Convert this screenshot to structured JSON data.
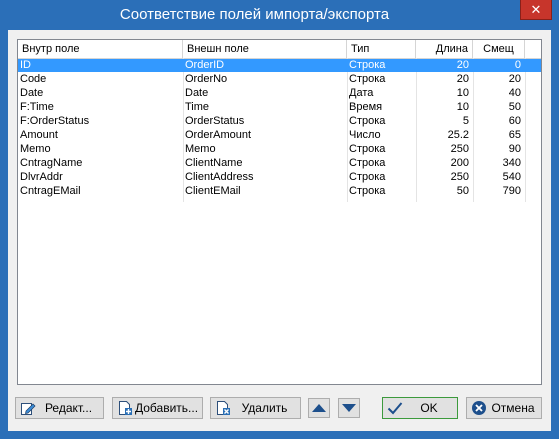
{
  "window": {
    "title": "Соответствие полей импорта/экспорта",
    "close_label": "✕"
  },
  "table": {
    "columns": [
      "Внутр поле",
      "Внешн поле",
      "Тип",
      "Длина",
      "Смещ"
    ],
    "rows": [
      [
        "ID",
        "OrderID",
        "Строка",
        "20",
        "0"
      ],
      [
        "Code",
        "OrderNo",
        "Строка",
        "20",
        "20"
      ],
      [
        "Date",
        "Date",
        "Дата",
        "10",
        "40"
      ],
      [
        "F:Time",
        "Time",
        "Время",
        "10",
        "50"
      ],
      [
        "F:OrderStatus",
        "OrderStatus",
        "Строка",
        "5",
        "60"
      ],
      [
        "Amount",
        "OrderAmount",
        "Число",
        "25.2",
        "65"
      ],
      [
        "Memo",
        "Memo",
        "Строка",
        "250",
        "90"
      ],
      [
        "CntragName",
        "ClientName",
        "Строка",
        "200",
        "340"
      ],
      [
        "DlvrAddr",
        "ClientAddress",
        "Строка",
        "250",
        "540"
      ],
      [
        "CntragEMail",
        "ClientEMail",
        "Строка",
        "50",
        "790"
      ]
    ],
    "selected_row": "ID"
  },
  "buttons": {
    "edit": "Редакт...",
    "add": "Добавить...",
    "delete": "Удалить",
    "ok": "OK",
    "cancel": "Отмена"
  },
  "colors": {
    "titlebar": "#2b6fb8",
    "selection": "#3399ff",
    "close": "#c7352b"
  }
}
